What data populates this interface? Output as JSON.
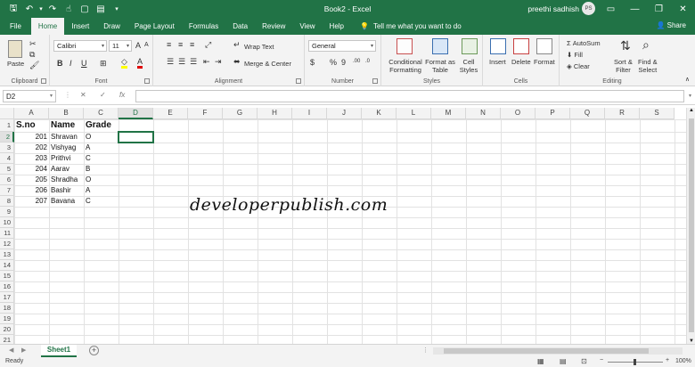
{
  "window": {
    "title": "Book2 - Excel",
    "user": "preethi sadhish",
    "avatar_initials": "PS",
    "minimize_icon": "—",
    "restore_icon": "❐",
    "close_icon": "✕",
    "ribbon_display_icon": "▭"
  },
  "qat": {
    "save": "🖫",
    "undo": "↶",
    "undo_dd": "▾",
    "redo": "↷",
    "touch": "☝",
    "new": "▢",
    "open": "▤",
    "customize": "▾"
  },
  "tabs": [
    "File",
    "Home",
    "Insert",
    "Draw",
    "Page Layout",
    "Formulas",
    "Data",
    "Review",
    "View",
    "Help"
  ],
  "active_tab": "Home",
  "tell_me": "Tell me what you want to do",
  "share": "Share",
  "ribbon": {
    "clipboard": {
      "label": "Clipboard",
      "paste": "Paste"
    },
    "font": {
      "label": "Font",
      "name": "Calibri",
      "size": "11",
      "bold": "B",
      "italic": "I",
      "underline": "U",
      "grow": "A",
      "shrink": "A"
    },
    "alignment": {
      "label": "Alignment",
      "wrap_text": "Wrap Text",
      "merge_center": "Merge & Center"
    },
    "number": {
      "label": "Number",
      "format": "General",
      "percent": "%",
      "comma": "9",
      "currency": "$",
      "inc_decimal": ".00",
      "dec_decimal": ".0"
    },
    "styles": {
      "label": "Styles",
      "conditional": "Conditional",
      "formatting": "Formatting",
      "format_as": "Format as",
      "table": "Table",
      "cell": "Cell",
      "styles": "Styles"
    },
    "cells": {
      "label": "Cells",
      "insert": "Insert",
      "delete": "Delete",
      "format": "Format"
    },
    "editing": {
      "label": "Editing",
      "autosum": "AutoSum",
      "fill": "Fill",
      "clear": "Clear",
      "sort_filter": "Sort &",
      "filter": "Filter",
      "find_select": "Find &",
      "select": "Select"
    }
  },
  "formula_bar": {
    "name_box": "D2",
    "cancel_icon": "✕",
    "enter_icon": "✓",
    "fx": "fx",
    "value": ""
  },
  "columns": [
    "A",
    "B",
    "C",
    "D",
    "E",
    "F",
    "G",
    "H",
    "I",
    "J",
    "K",
    "L",
    "M",
    "N",
    "O",
    "P",
    "Q",
    "R",
    "S"
  ],
  "rows": [
    "1",
    "2",
    "3",
    "4",
    "5",
    "6",
    "7",
    "8",
    "9",
    "10",
    "11",
    "12",
    "13",
    "14",
    "15",
    "16",
    "17",
    "18",
    "19",
    "20",
    "21"
  ],
  "selected_cell": "D2",
  "table": {
    "headers": [
      "S.no",
      "Name",
      "Grade"
    ],
    "rows": [
      [
        "201",
        "Shravan",
        "O"
      ],
      [
        "202",
        "Vishyag",
        "A"
      ],
      [
        "203",
        "Prithvi",
        "C"
      ],
      [
        "204",
        "Aarav",
        "B"
      ],
      [
        "205",
        "Shradha",
        "O"
      ],
      [
        "206",
        "Bashir",
        "A"
      ],
      [
        "207",
        "Bavana",
        "C"
      ]
    ]
  },
  "watermark": "developerpublish.com",
  "sheets": [
    "Sheet1"
  ],
  "status": {
    "mode": "Ready",
    "zoom": "100%",
    "zoom_minus": "−",
    "zoom_plus": "+"
  }
}
